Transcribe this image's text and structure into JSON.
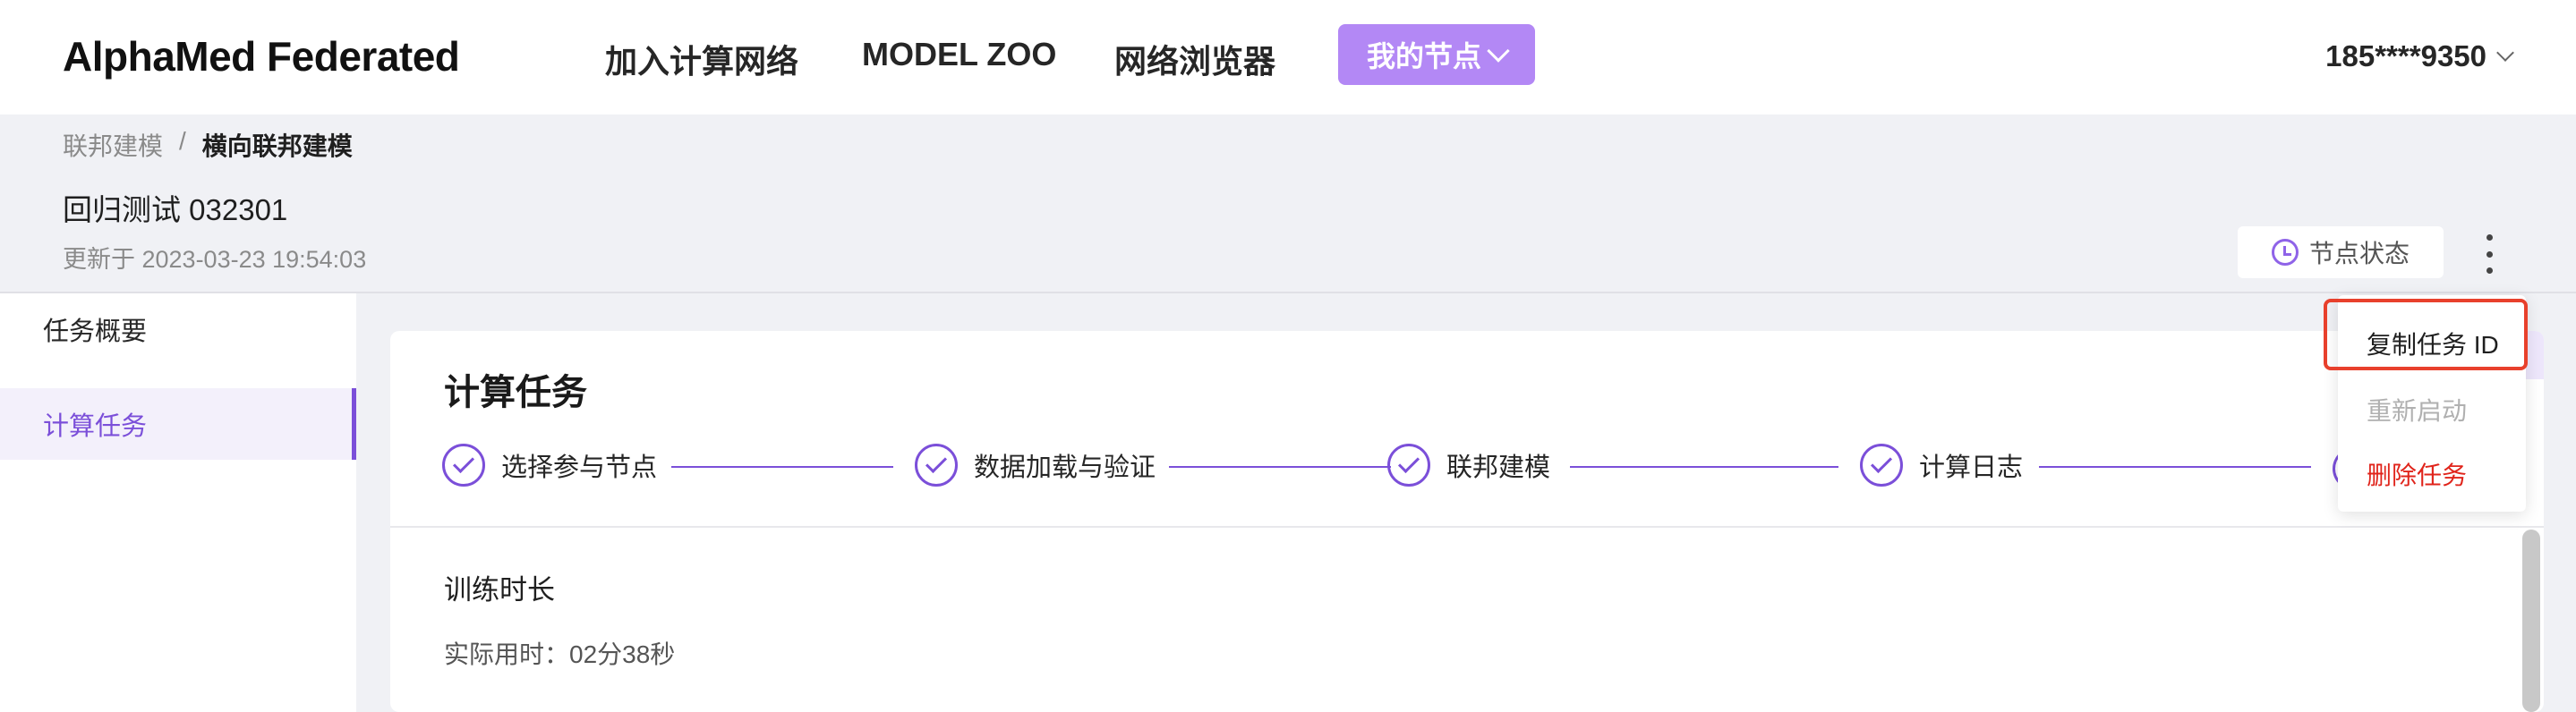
{
  "app": {
    "brand": "AlphaMed Federated"
  },
  "nav": {
    "items": [
      "加入计算网络",
      "MODEL ZOO",
      "网络浏览器"
    ],
    "my_node": "我的节点",
    "user": "185****9350"
  },
  "breadcrumb": {
    "parent": "联邦建模",
    "separator": "/",
    "current": "横向联邦建模"
  },
  "task": {
    "title": "回归测试 032301",
    "updated": "更新于 2023-03-23 19:54:03",
    "node_status_label": "节点状态"
  },
  "menu": {
    "copy_id": "复制任务 ID",
    "restart": "重新启动",
    "delete": "删除任务"
  },
  "sidebar": {
    "items": [
      {
        "label": "任务概要"
      },
      {
        "label": "计算任务"
      }
    ],
    "active": 1
  },
  "main": {
    "title": "计算任务",
    "steps": [
      "选择参与节点",
      "数据加载与验证",
      "联邦建模",
      "计算日志"
    ],
    "section_title": "训练时长",
    "section_value": "实际用时：02分38秒"
  },
  "colors": {
    "accent": "#7b4fd9",
    "nav_button": "#b388f5",
    "danger": "#e0241b",
    "highlight": "#e8402c"
  }
}
